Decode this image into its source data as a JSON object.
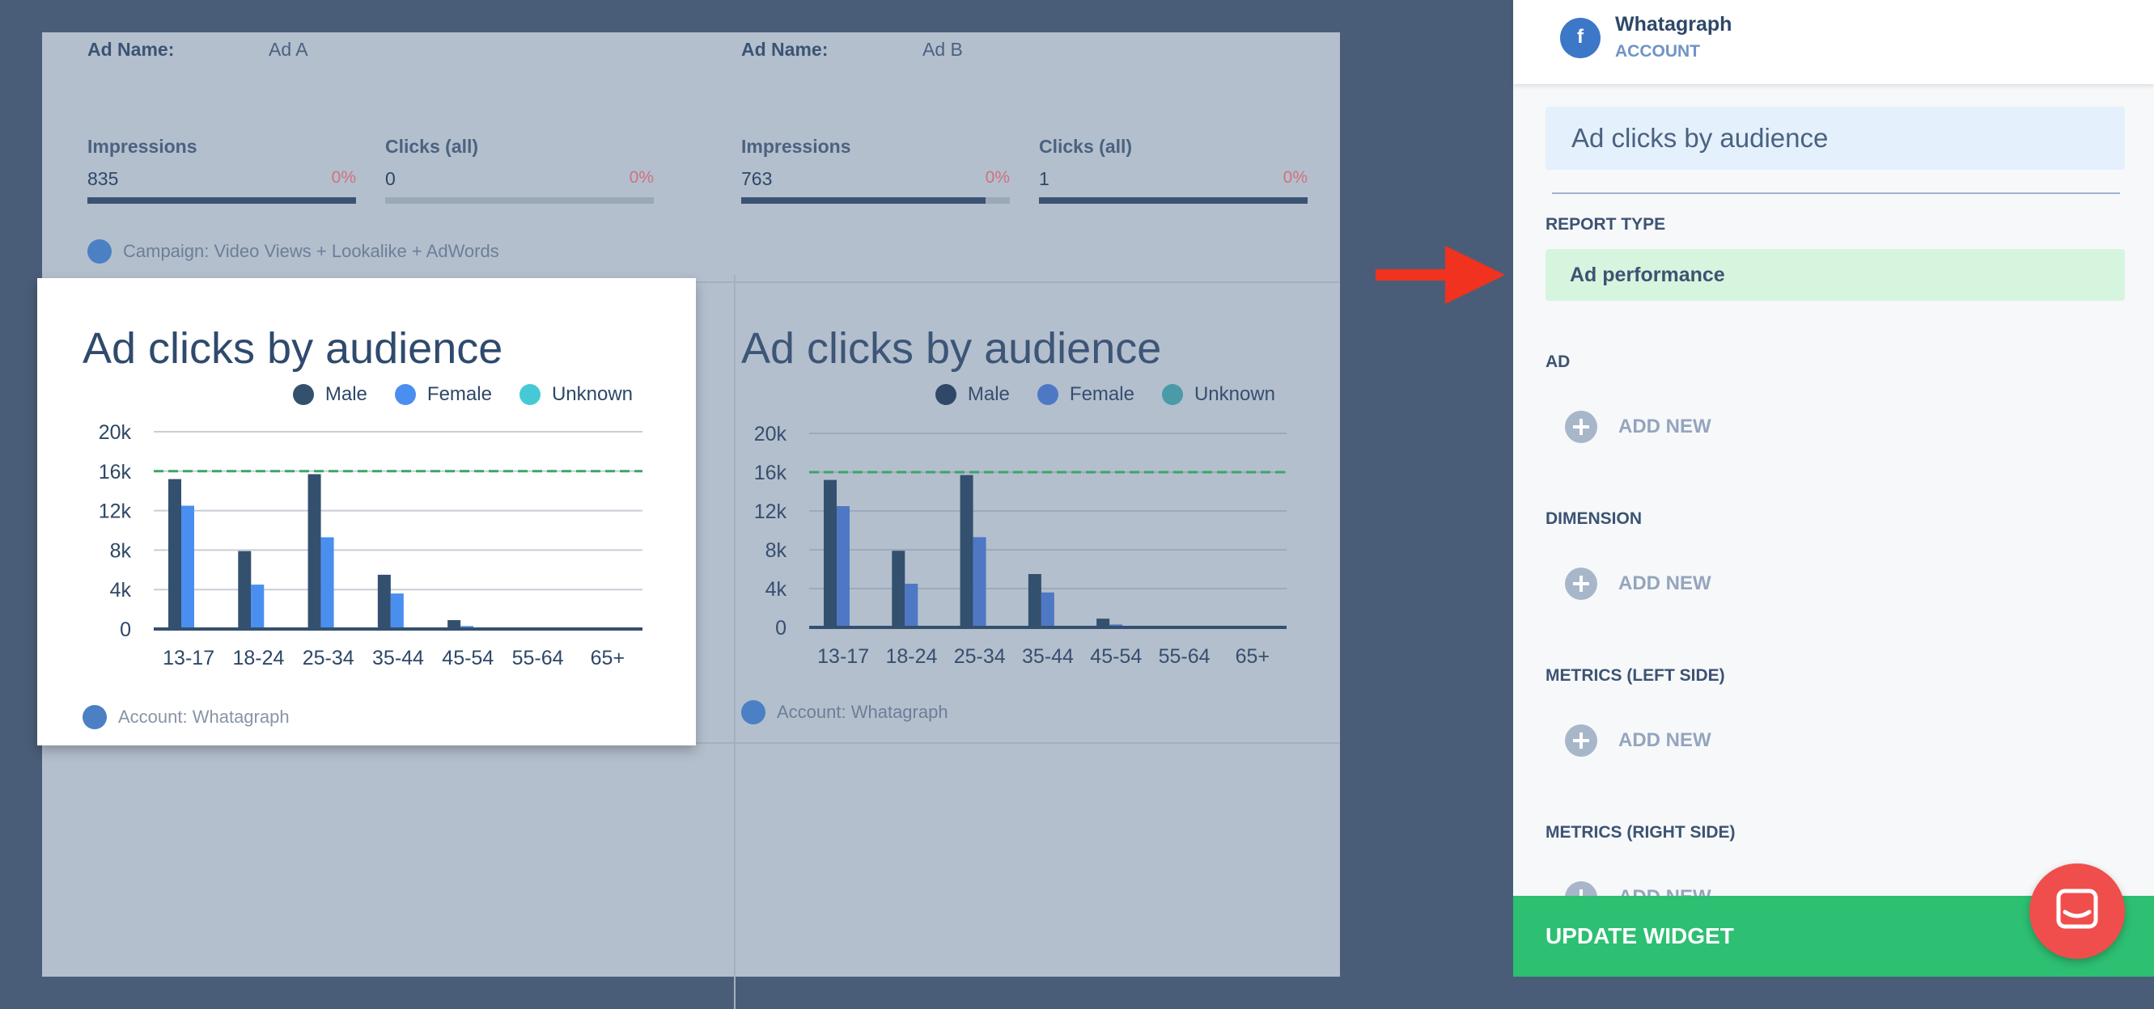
{
  "ads": [
    {
      "name_label": "Ad Name:",
      "name": "Ad A",
      "metrics": [
        {
          "label": "Impressions",
          "value": "835",
          "pct": "0%",
          "fill": 1.0
        },
        {
          "label": "Clicks (all)",
          "value": "0",
          "pct": "0%",
          "fill": 0.0
        }
      ],
      "campaign": "Campaign: Video Views + Lookalike + AdWords"
    },
    {
      "name_label": "Ad Name:",
      "name": "Ad B",
      "metrics": [
        {
          "label": "Impressions",
          "value": "763",
          "pct": "0%",
          "fill": 0.91
        },
        {
          "label": "Clicks (all)",
          "value": "1",
          "pct": "0%",
          "fill": 1.0
        }
      ]
    }
  ],
  "widgets": [
    {
      "title": "Ad clicks by audience",
      "footer": "Account: Whatagraph"
    },
    {
      "title": "Ad clicks by audience",
      "footer": "Account: Whatagraph"
    }
  ],
  "chart_data": {
    "type": "bar",
    "title": "Ad clicks by audience",
    "categories": [
      "13-17",
      "18-24",
      "25-34",
      "35-44",
      "45-54",
      "55-64",
      "65+"
    ],
    "series": [
      {
        "name": "Male",
        "color": "#34506f",
        "values": [
          15200,
          7900,
          15700,
          5500,
          900,
          0,
          0
        ]
      },
      {
        "name": "Female",
        "color": "#4a8ef0",
        "values": [
          12500,
          4500,
          9300,
          3600,
          300,
          0,
          0
        ]
      },
      {
        "name": "Unknown",
        "color": "#46c9d6",
        "values": [
          0,
          0,
          0,
          0,
          0,
          0,
          0
        ]
      }
    ],
    "y_ticks": [
      "0",
      "4k",
      "8k",
      "12k",
      "16k",
      "20k"
    ],
    "ylim": [
      0,
      20000
    ],
    "reference_line": 16000,
    "reference_line_color": "#3aa66a",
    "legend_position": "top-right",
    "grid": true
  },
  "panel": {
    "account_name": "Whatagraph",
    "account_type": "ACCOUNT",
    "account_icon": "facebook-ads-icon",
    "widget_title": "Ad clicks by audience",
    "report_type_label": "REPORT TYPE",
    "report_type_value": "Ad performance",
    "sections": [
      {
        "label": "AD",
        "add": "ADD NEW"
      },
      {
        "label": "DIMENSION",
        "add": "ADD NEW"
      },
      {
        "label": "METRICS (LEFT SIDE)",
        "add": "ADD NEW"
      },
      {
        "label": "METRICS (RIGHT SIDE)",
        "add": "ADD NEW"
      }
    ],
    "update_button": "UPDATE WIDGET"
  },
  "colors": {
    "accent_green": "#2dbf72",
    "arrow_red": "#f0321f",
    "chat_red": "#f04e4c"
  }
}
